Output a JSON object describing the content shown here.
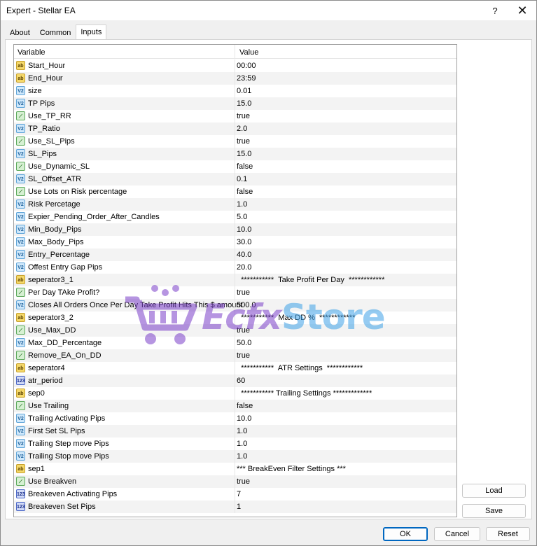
{
  "window": {
    "title": "Expert - Stellar EA",
    "help_glyph": "?",
    "close_glyph": "✕"
  },
  "tabs": [
    "About",
    "Common",
    "Inputs"
  ],
  "active_tab": "Inputs",
  "grid": {
    "headers": {
      "variable": "Variable",
      "value": "Value"
    },
    "rows": [
      {
        "icon": "ab",
        "name": "Start_Hour",
        "value": "00:00"
      },
      {
        "icon": "ab",
        "name": "End_Hour",
        "value": "23:59"
      },
      {
        "icon": "va",
        "name": "size",
        "value": "0.01"
      },
      {
        "icon": "va",
        "name": "TP Pips",
        "value": "15.0"
      },
      {
        "icon": "bo",
        "name": "Use_TP_RR",
        "value": "true"
      },
      {
        "icon": "va",
        "name": "TP_Ratio",
        "value": "2.0"
      },
      {
        "icon": "bo",
        "name": "Use_SL_Pips",
        "value": "true"
      },
      {
        "icon": "va",
        "name": "SL_Pips",
        "value": "15.0"
      },
      {
        "icon": "bo",
        "name": "Use_Dynamic_SL",
        "value": "false"
      },
      {
        "icon": "va",
        "name": "SL_Offset_ATR",
        "value": "0.1"
      },
      {
        "icon": "bo",
        "name": "Use Lots on Risk percentage",
        "value": "false"
      },
      {
        "icon": "va",
        "name": "Risk Percetage",
        "value": "1.0"
      },
      {
        "icon": "va",
        "name": "Expier_Pending_Order_After_Candles",
        "value": "5.0"
      },
      {
        "icon": "va",
        "name": "Min_Body_Pips",
        "value": "10.0"
      },
      {
        "icon": "va",
        "name": "Max_Body_Pips",
        "value": "30.0"
      },
      {
        "icon": "va",
        "name": "Entry_Percentage",
        "value": "40.0"
      },
      {
        "icon": "va",
        "name": "Offest Entry Gap Pips",
        "value": "20.0"
      },
      {
        "icon": "ab",
        "name": "seperator3_1",
        "value": "  ***********  Take Profit Per Day  ************"
      },
      {
        "icon": "bo",
        "name": "Per Day TAke Profit?",
        "value": "true"
      },
      {
        "icon": "va",
        "name": "Closes All Orders Once Per Day Take Profit Hits This $ amount",
        "value": "500.0"
      },
      {
        "icon": "ab",
        "name": "seperator3_2",
        "value": "  ***********  Max DD %  ************"
      },
      {
        "icon": "bo",
        "name": "Use_Max_DD",
        "value": "true"
      },
      {
        "icon": "va",
        "name": "Max_DD_Percentage",
        "value": "50.0"
      },
      {
        "icon": "bo",
        "name": "Remove_EA_On_DD",
        "value": "true"
      },
      {
        "icon": "ab",
        "name": "seperator4",
        "value": "  ***********  ATR Settings  ************"
      },
      {
        "icon": "in",
        "name": "atr_period",
        "value": "60"
      },
      {
        "icon": "ab",
        "name": "sep0",
        "value": "  *********** Trailing Settings *************"
      },
      {
        "icon": "bo",
        "name": "Use Trailing",
        "value": "false"
      },
      {
        "icon": "va",
        "name": "Trailing Activating Pips",
        "value": "10.0"
      },
      {
        "icon": "va",
        "name": "First Set SL  Pips",
        "value": "1.0"
      },
      {
        "icon": "va",
        "name": "Trailing Step move Pips",
        "value": "1.0"
      },
      {
        "icon": "va",
        "name": "Trailing Stop move Pips",
        "value": "1.0"
      },
      {
        "icon": "ab",
        "name": "sep1",
        "value": "*** BreakEven Filter Settings ***"
      },
      {
        "icon": "bo",
        "name": "Use Breakven",
        "value": "true"
      },
      {
        "icon": "in",
        "name": "Breakeven Activating Pips",
        "value": "7"
      },
      {
        "icon": "in",
        "name": "Breakeven Set Pips",
        "value": "1"
      }
    ]
  },
  "icon_labels": {
    "ab": "ab",
    "va": "V2",
    "bo": "⟋",
    "in": "123"
  },
  "watermark": {
    "brand1": "Ecfx",
    "brand2": "Store"
  },
  "buttons": {
    "load": "Load",
    "save": "Save",
    "ok": "OK",
    "cancel": "Cancel",
    "reset": "Reset"
  }
}
